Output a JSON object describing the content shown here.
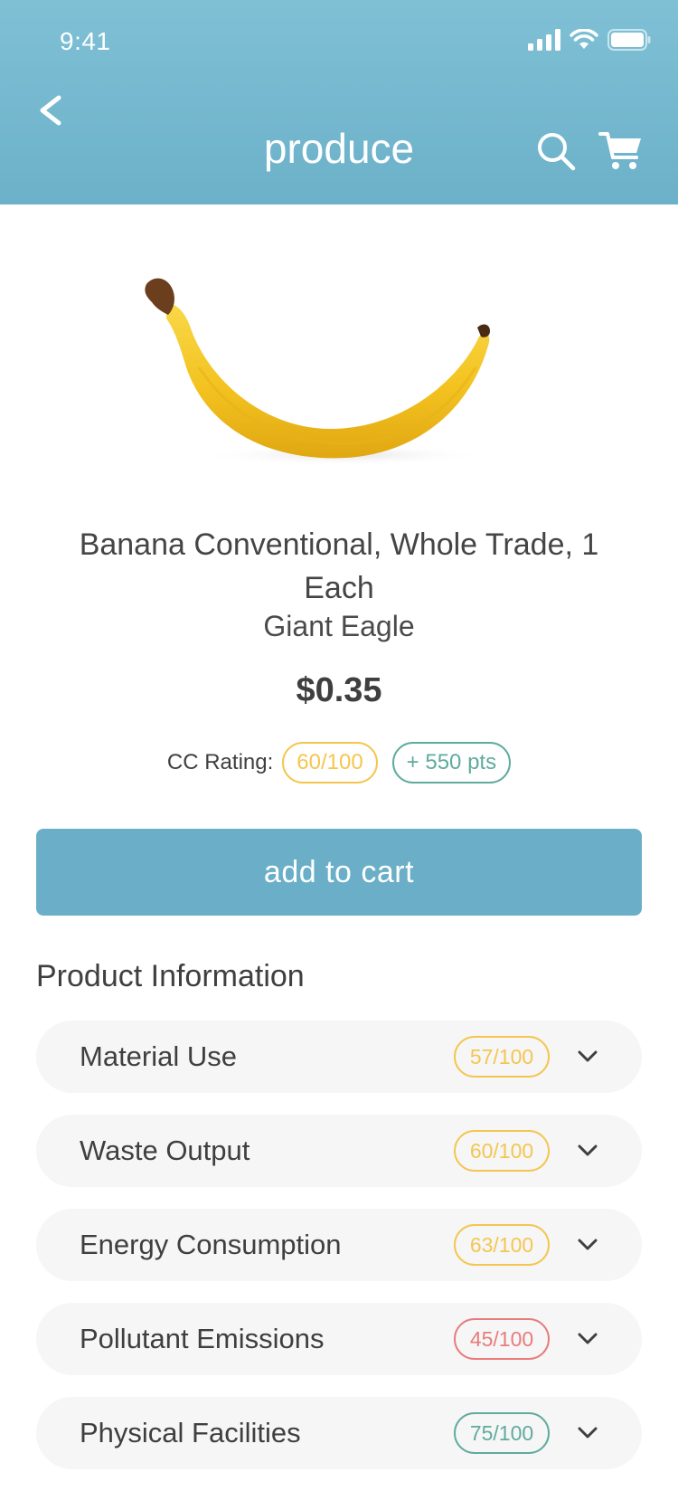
{
  "status_bar": {
    "time": "9:41"
  },
  "header": {
    "title": "produce"
  },
  "product": {
    "name": "Banana Conventional, Whole Trade, 1 Each",
    "store": "Giant Eagle",
    "price": "$0.35",
    "rating_label": "CC Rating:",
    "rating_score": "60/100",
    "points": "+ 550 pts"
  },
  "actions": {
    "add_to_cart": "add to cart"
  },
  "product_info": {
    "title": "Product Information",
    "items": [
      {
        "label": "Material Use",
        "score": "57/100",
        "color": "#f4c650"
      },
      {
        "label": "Waste Output",
        "score": "60/100",
        "color": "#f4c650"
      },
      {
        "label": "Energy Consumption",
        "score": "63/100",
        "color": "#f4c650"
      },
      {
        "label": "Pollutant Emissions",
        "score": "45/100",
        "color": "#e87c7c"
      },
      {
        "label": "Physical Facilities",
        "score": "75/100",
        "color": "#5fab9e"
      }
    ]
  },
  "colors": {
    "header": "#6cb1c9",
    "button": "#6aafc7",
    "rating_yellow": "#f4c650",
    "points_teal": "#5fab9e",
    "rating_red": "#e87c7c"
  }
}
